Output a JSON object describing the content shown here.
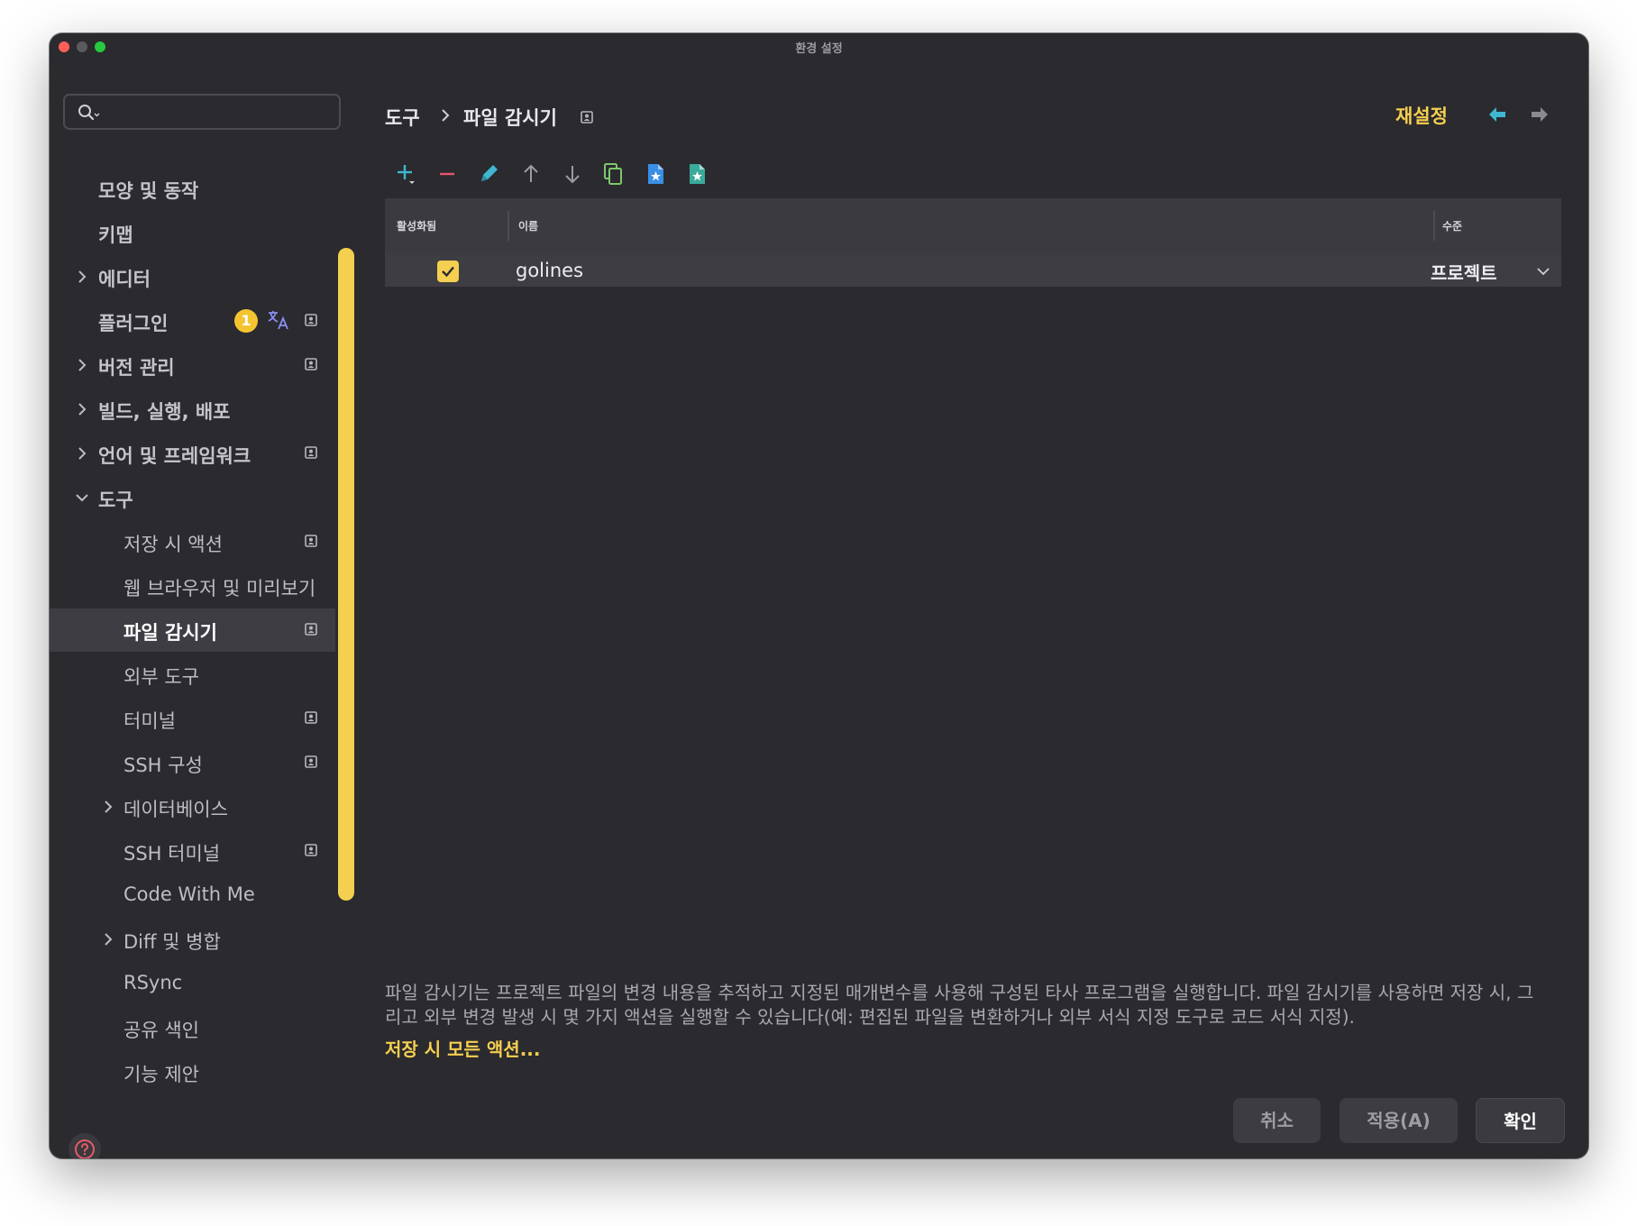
{
  "window": {
    "title": "환경 설정"
  },
  "sidebar": {
    "search": {
      "value": "",
      "placeholder": ""
    },
    "items": [
      {
        "label": "모양 및 동작",
        "expandable": false,
        "project_icon": false
      },
      {
        "label": "키맵",
        "expandable": false,
        "project_icon": false
      },
      {
        "label": "에디터",
        "expandable": true,
        "expanded": false,
        "project_icon": false
      },
      {
        "label": "플러그인",
        "expandable": false,
        "project_icon": true,
        "badge": "1"
      },
      {
        "label": "버전 관리",
        "expandable": true,
        "expanded": false,
        "project_icon": true
      },
      {
        "label": "빌드, 실행, 배포",
        "expandable": true,
        "expanded": false,
        "project_icon": false
      },
      {
        "label": "언어 및 프레임워크",
        "expandable": true,
        "expanded": false,
        "project_icon": true
      },
      {
        "label": "도구",
        "expandable": true,
        "expanded": true,
        "project_icon": false
      },
      {
        "label": "저장 시 액션",
        "child": true,
        "project_icon": true
      },
      {
        "label": "웹 브라우저 및 미리보기",
        "child": true,
        "project_icon": false
      },
      {
        "label": "파일 감시기",
        "child": true,
        "project_icon": true,
        "selected": true
      },
      {
        "label": "외부 도구",
        "child": true,
        "project_icon": false
      },
      {
        "label": "터미널",
        "child": true,
        "project_icon": true
      },
      {
        "label": "SSH 구성",
        "child": true,
        "project_icon": true
      },
      {
        "label": "데이터베이스",
        "child": true,
        "expandable": true,
        "project_icon": false
      },
      {
        "label": "SSH 터미널",
        "child": true,
        "project_icon": true
      },
      {
        "label": "Code With Me",
        "child": true,
        "project_icon": false
      },
      {
        "label": "Diff 및 병합",
        "child": true,
        "expandable": true,
        "project_icon": false
      },
      {
        "label": "RSync",
        "child": true,
        "project_icon": false
      },
      {
        "label": "공유 색인",
        "child": true,
        "project_icon": false
      },
      {
        "label": "기능 제안",
        "child": true,
        "project_icon": false
      }
    ]
  },
  "header": {
    "breadcrumb": [
      "도구",
      "파일 감시기"
    ],
    "reset_label": "재설정"
  },
  "toolbar": {
    "buttons": [
      "add-icon",
      "remove-icon",
      "edit-icon",
      "move-up-icon",
      "move-down-icon",
      "copy-icon",
      "import-icon",
      "export-icon"
    ]
  },
  "table": {
    "columns": [
      "활성화됨",
      "이름",
      "수준"
    ],
    "rows": [
      {
        "enabled": true,
        "name": "golines",
        "level": "프로젝트"
      }
    ]
  },
  "description": {
    "line1": "파일 감시기는 프로젝트 파일의 변경 내용을 추적하고 지정된 매개변수를 사용해 구성된 타사 프로그램을 실행합니다. 파일 감시기를 사용하면 저장 시, 그",
    "line2": "리고 외부 변경 발생 시 몇 가지 액션을 실행할 수 있습니다(예: 편집된 파일을 변환하거나 외부 서식 지정 도구로 코드 서식 지정).",
    "link": "저장 시 모든 액션..."
  },
  "footer": {
    "cancel": "취소",
    "apply": "적용(A)",
    "ok": "확인"
  },
  "colors": {
    "accent": "#f5cf4f",
    "window_bg": "#2b2a2f",
    "selection_bg": "#3e3d43"
  }
}
